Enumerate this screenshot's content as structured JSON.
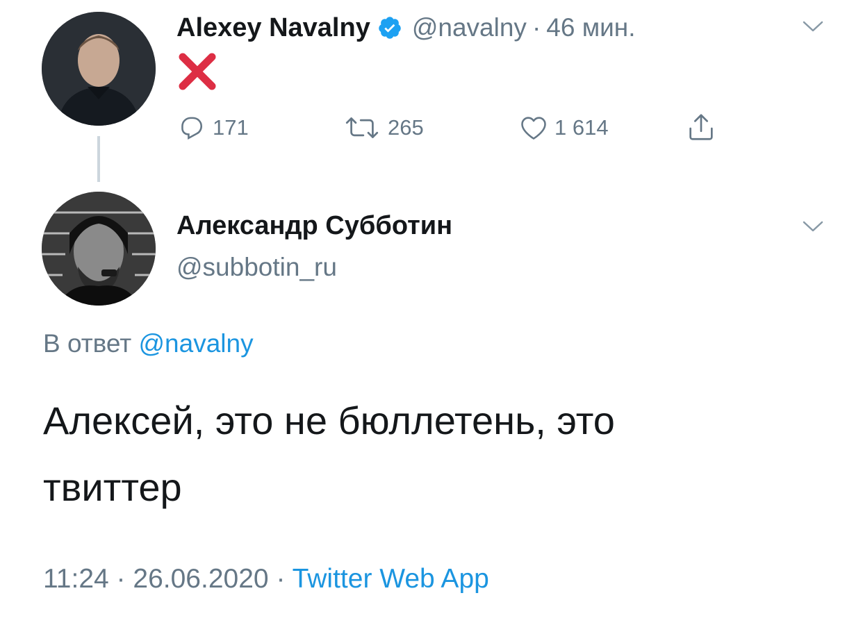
{
  "original_tweet": {
    "author_name": "Alexey Navalny",
    "handle": "@navalny",
    "separator": "·",
    "time_ago": "46 мин.",
    "content_icon": "red-cross-mark",
    "actions": {
      "replies": "171",
      "retweets": "265",
      "likes": "1 614"
    }
  },
  "reply_tweet": {
    "author_name": "Александр Субботин",
    "handle": "@subbotin_ru",
    "reply_to_prefix": "В ответ",
    "reply_to_handle": "@navalny",
    "text_line1": "Алексей, это не бюллетень, это",
    "text_line2": "твиттер",
    "timestamp_time": "11:24",
    "timestamp_date": "26.06.2020",
    "separator": "·",
    "source": "Twitter Web App"
  },
  "colors": {
    "text": "#14171a",
    "muted": "#657786",
    "link": "#1b95e0",
    "verified": "#1da1f2",
    "cross": "#dd2e44",
    "thread_line": "#ccd6dd"
  }
}
